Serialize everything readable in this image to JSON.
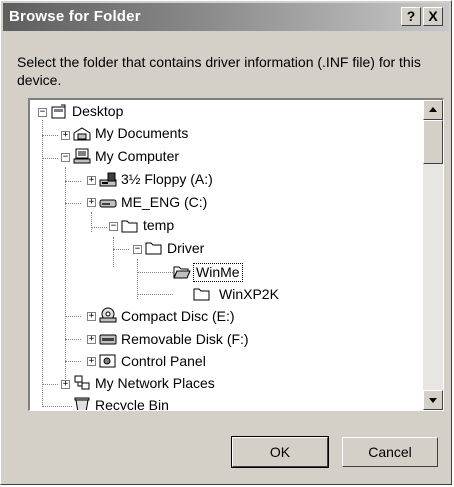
{
  "window": {
    "title": "Browse for Folder",
    "help_label": "?",
    "close_label": "X"
  },
  "instruction": "Select the folder that contains driver information (.INF file) for this device.",
  "tree": {
    "items": [
      {
        "label": "Desktop",
        "icon": "desktop-icon",
        "expander": "−"
      },
      {
        "label": "My Documents",
        "icon": "my-documents-icon",
        "expander": "+"
      },
      {
        "label": "My Computer",
        "icon": "my-computer-icon",
        "expander": "−"
      },
      {
        "label": "3½ Floppy (A:)",
        "icon": "floppy-drive-icon",
        "expander": "+"
      },
      {
        "label": "ME_ENG (C:)",
        "icon": "hard-drive-icon",
        "expander": "+"
      },
      {
        "label": "temp",
        "icon": "folder-icon",
        "expander": "−"
      },
      {
        "label": "Driver",
        "icon": "folder-icon",
        "expander": "−"
      },
      {
        "label": "WinMe",
        "icon": "open-folder-icon",
        "expander": "",
        "selected": true
      },
      {
        "label": "WinXP2K",
        "icon": "folder-icon",
        "expander": ""
      },
      {
        "label": "Compact Disc (E:)",
        "icon": "cd-drive-icon",
        "expander": "+"
      },
      {
        "label": "Removable Disk (F:)",
        "icon": "removable-disk-icon",
        "expander": "+"
      },
      {
        "label": "Control Panel",
        "icon": "control-panel-icon",
        "expander": "+"
      },
      {
        "label": "My Network Places",
        "icon": "network-places-icon",
        "expander": "+"
      },
      {
        "label": "Recycle Bin",
        "icon": "recycle-bin-icon",
        "expander": ""
      }
    ]
  },
  "buttons": {
    "ok_label": "OK",
    "cancel_label": "Cancel"
  }
}
